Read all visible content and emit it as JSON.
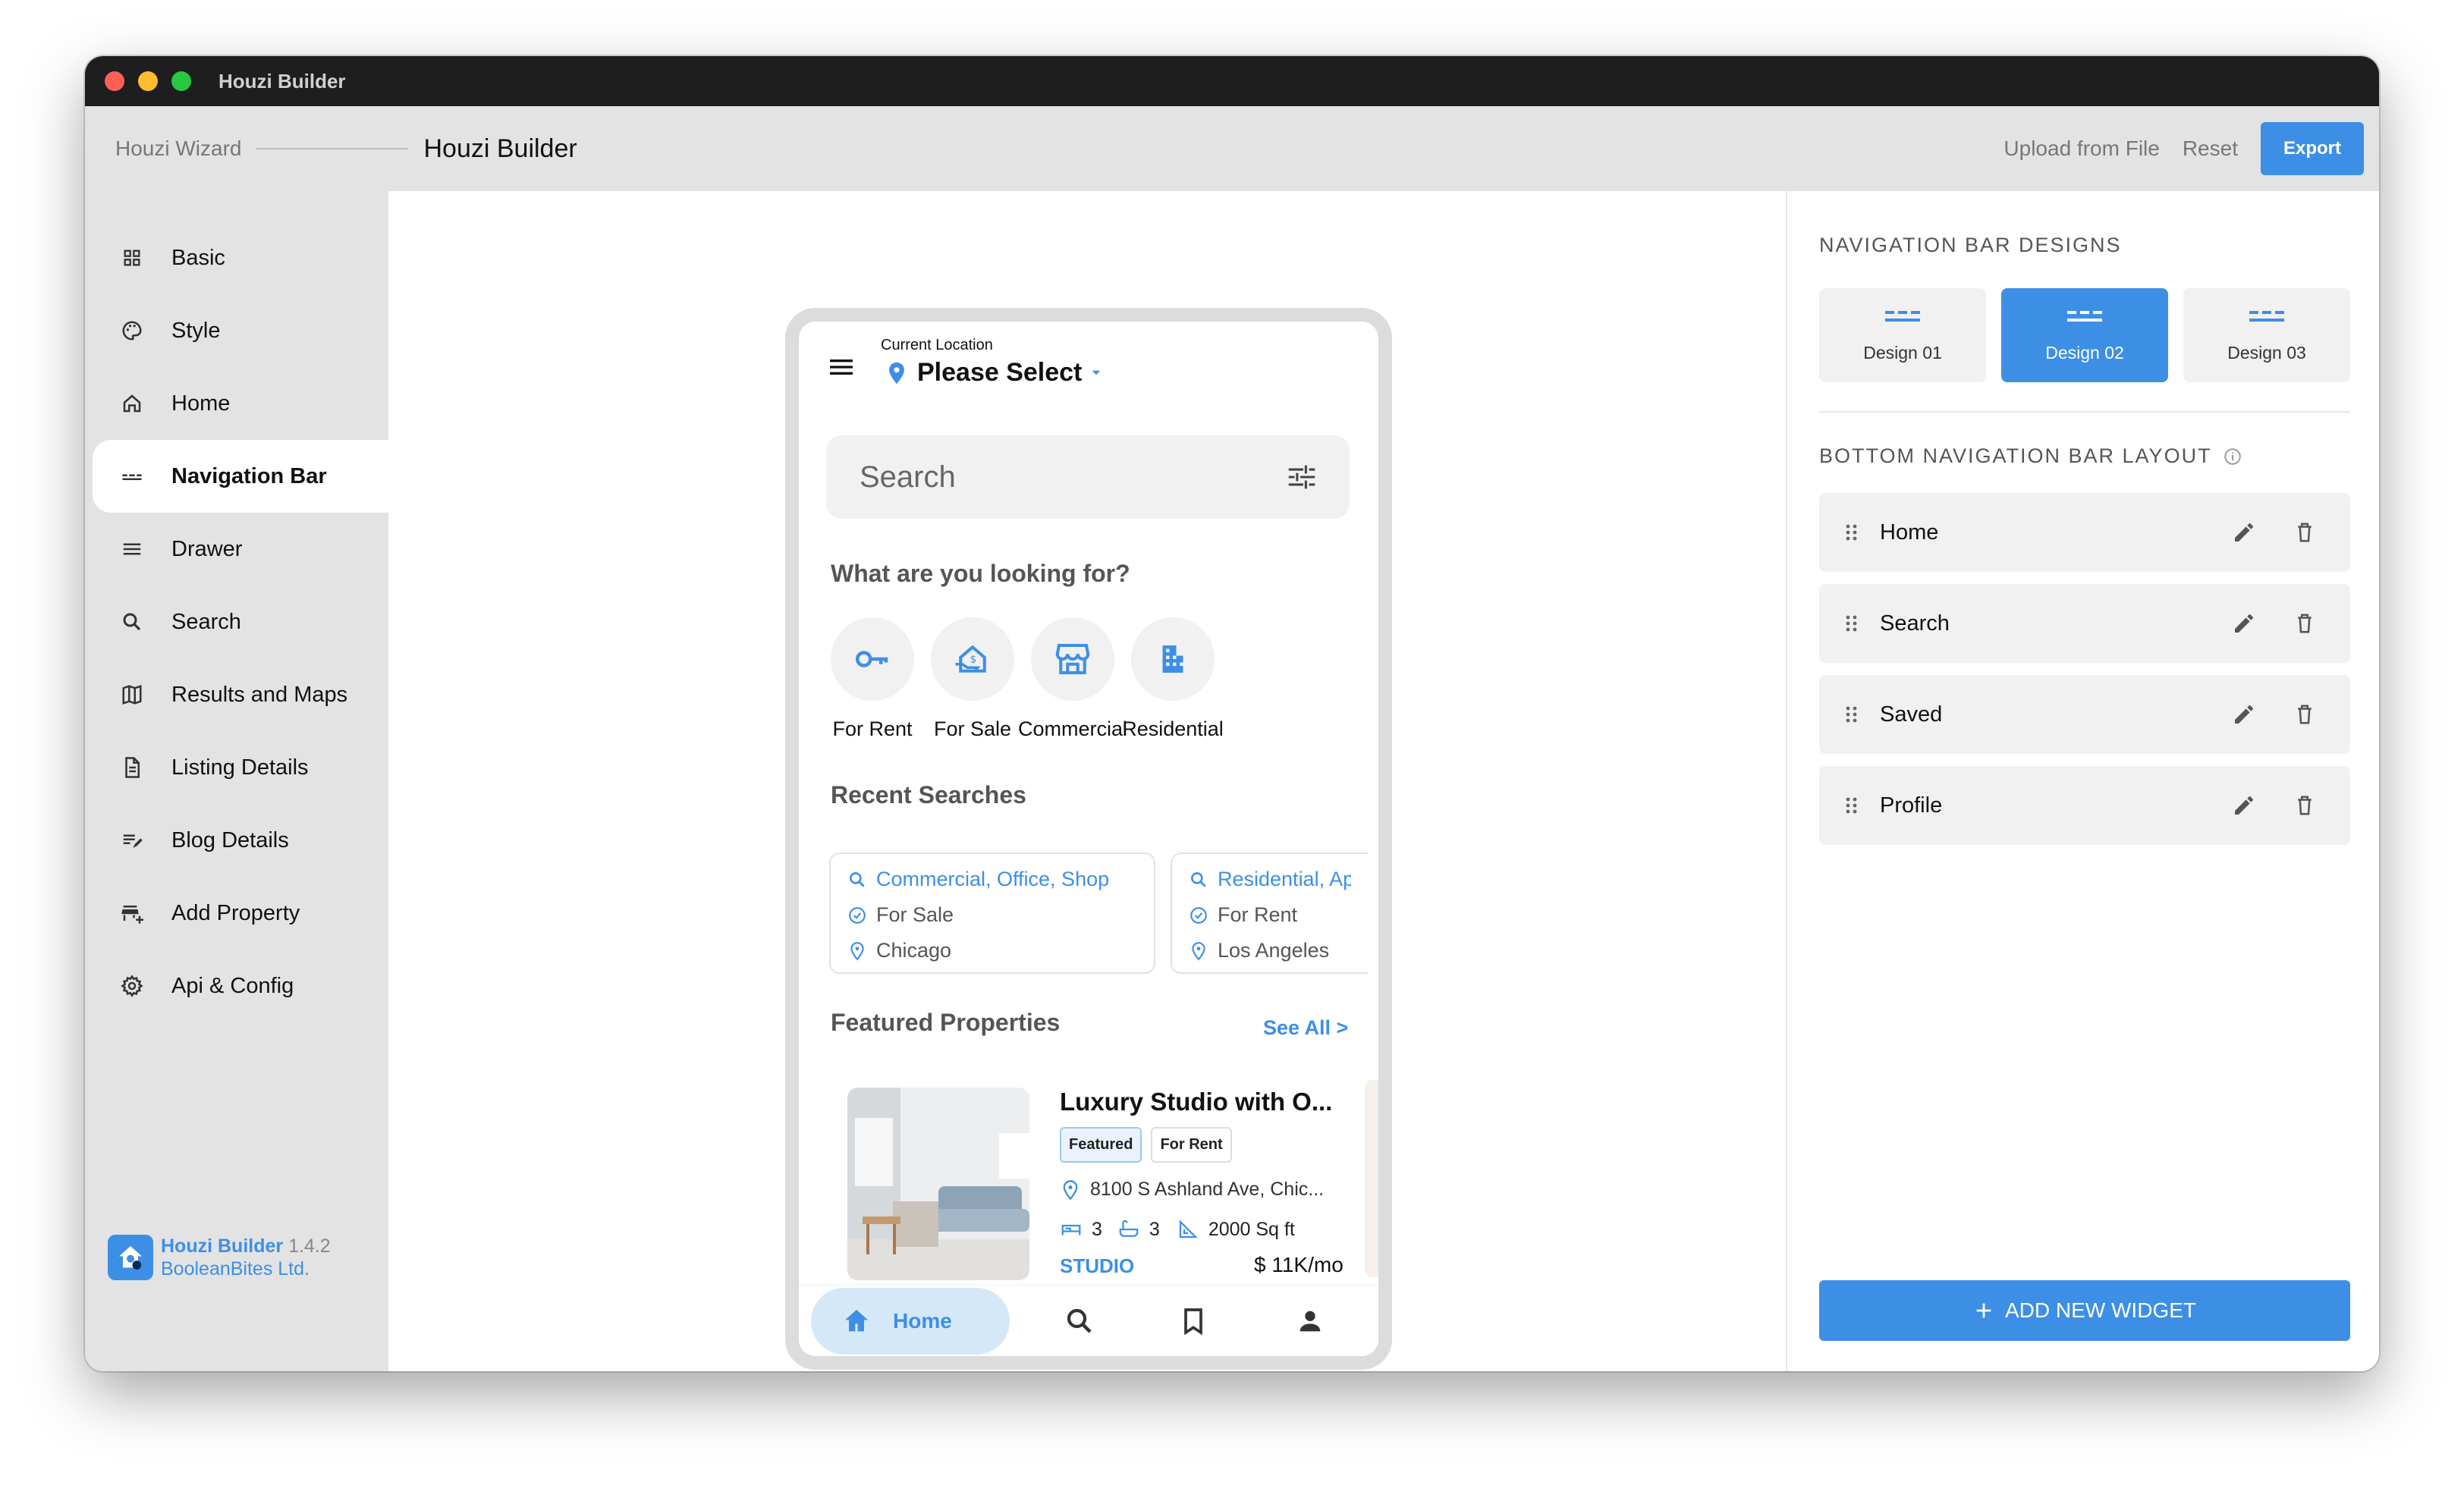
{
  "window": {
    "title": "Houzi Builder"
  },
  "appbar": {
    "breadcrumb_root": "Houzi Wizard",
    "breadcrumb_current": "Houzi Builder",
    "upload_label": "Upload from File",
    "reset_label": "Reset",
    "export_label": "Export"
  },
  "sidebar": {
    "items": [
      {
        "label": "Basic",
        "icon": "grid-icon"
      },
      {
        "label": "Style",
        "icon": "palette-icon"
      },
      {
        "label": "Home",
        "icon": "home-icon"
      },
      {
        "label": "Navigation Bar",
        "icon": "nav-bar-icon",
        "active": true
      },
      {
        "label": "Drawer",
        "icon": "menu-icon"
      },
      {
        "label": "Search",
        "icon": "search-icon"
      },
      {
        "label": "Results and Maps",
        "icon": "map-icon"
      },
      {
        "label": "Listing Details",
        "icon": "document-icon"
      },
      {
        "label": "Blog Details",
        "icon": "edit-note-icon"
      },
      {
        "label": "Add Property",
        "icon": "add-business-icon"
      },
      {
        "label": "Api & Config",
        "icon": "gear-icon"
      }
    ],
    "footer": {
      "app_name": "Houzi Builder",
      "version": "1.4.2",
      "company": "BooleanBites Ltd."
    }
  },
  "phone": {
    "location_label": "Current Location",
    "location_value": "Please Select",
    "search_placeholder": "Search",
    "looking_for_title": "What are you looking for?",
    "categories": [
      {
        "label": "For Rent",
        "icon": "key-icon"
      },
      {
        "label": "For Sale",
        "icon": "house-dollar-icon"
      },
      {
        "label": "Commercial",
        "icon": "storefront-icon"
      },
      {
        "label": "Residential",
        "icon": "apartment-icon"
      }
    ],
    "recent_title": "Recent Searches",
    "recent": [
      {
        "query": "Commercial, Office, Shop",
        "status": "For Sale",
        "location": "Chicago"
      },
      {
        "query": "Residential, Ap",
        "status": "For Rent",
        "location": "Los Angeles"
      }
    ],
    "featured_title": "Featured Properties",
    "see_all": "See All >",
    "property": {
      "title": "Luxury Studio with O...",
      "tags": [
        "Featured",
        "For Rent"
      ],
      "address": "8100 S Ashland Ave, Chic...",
      "beds": "3",
      "baths": "3",
      "area": "2000 Sq ft",
      "type": "STUDIO",
      "price": "$ 11K/mo"
    },
    "bottom_nav": {
      "home_label": "Home"
    }
  },
  "right_panel": {
    "designs_title": "NAVIGATION BAR DESIGNS",
    "designs": [
      {
        "label": "Design 01",
        "selected": false
      },
      {
        "label": "Design 02",
        "selected": true
      },
      {
        "label": "Design 03",
        "selected": false
      }
    ],
    "layout_title": "BOTTOM NAVIGATION BAR LAYOUT",
    "widgets": [
      "Home",
      "Search",
      "Saved",
      "Profile"
    ],
    "add_button": "ADD NEW WIDGET"
  },
  "colors": {
    "accent": "#3d8fe6",
    "sidebar_bg": "#e3e3e3",
    "titlebar": "#1e1e1e"
  }
}
